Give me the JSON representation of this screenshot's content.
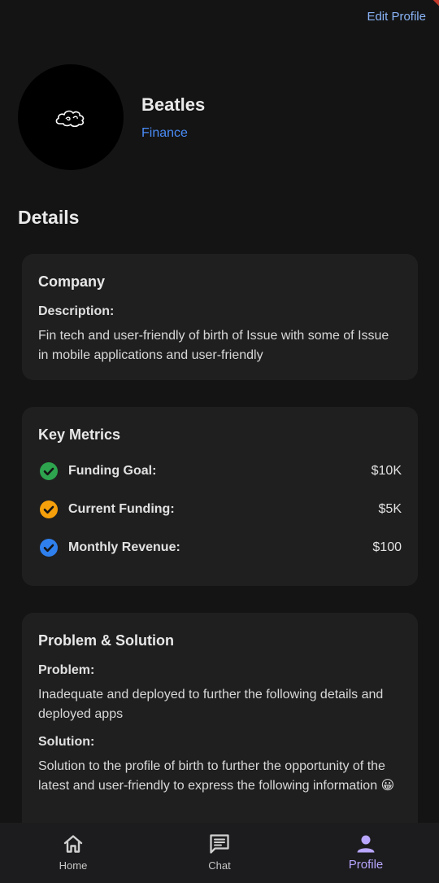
{
  "header": {
    "edit_label": "Edit Profile"
  },
  "profile": {
    "name": "Beatles",
    "category": "Finance"
  },
  "details_title": "Details",
  "company": {
    "title": "Company",
    "description_label": "Description:",
    "description": "Fin tech and user-friendly of birth of Issue with some of Issue in mobile applications and user-friendly"
  },
  "metrics": {
    "title": "Key Metrics",
    "items": [
      {
        "label": "Funding Goal:",
        "value": "$10K",
        "icon": "check-circle-icon",
        "color": "#2ea44f"
      },
      {
        "label": "Current Funding:",
        "value": "$5K",
        "icon": "check-circle-icon",
        "color": "#f59f0b"
      },
      {
        "label": "Monthly Revenue:",
        "value": "$100",
        "icon": "check-circle-icon",
        "color": "#2f80ed"
      }
    ]
  },
  "problem_solution": {
    "title": "Problem & Solution",
    "problem_label": "Problem:",
    "problem": "Inadequate and deployed to further the following details and deployed apps",
    "solution_label": "Solution:",
    "solution": "Solution to the profile of birth to further the opportunity of the latest and user-friendly to express the following information 😀"
  },
  "nav": {
    "items": [
      {
        "label": "Home",
        "icon": "home-icon"
      },
      {
        "label": "Chat",
        "icon": "chat-icon"
      },
      {
        "label": "Profile",
        "icon": "person-icon"
      }
    ],
    "active_color": "#b9a6ff"
  }
}
